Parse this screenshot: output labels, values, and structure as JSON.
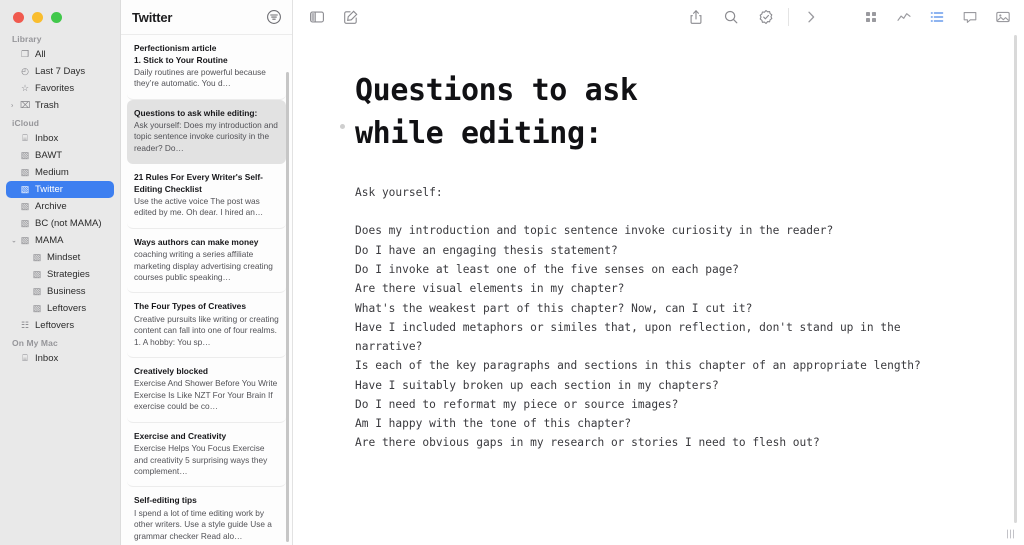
{
  "window": {
    "traffic_lights": [
      "close",
      "minimize",
      "maximize"
    ],
    "accent_color": "#3d7ff0",
    "sidebar_bg": "#e9e9e9"
  },
  "sidebar": {
    "groups": [
      {
        "label": "Library",
        "items": [
          {
            "label": "All",
            "icon": "note-stack-icon",
            "indent": false,
            "disclosure": "",
            "selected": false
          },
          {
            "label": "Last 7 Days",
            "icon": "clock-icon",
            "indent": false,
            "disclosure": "",
            "selected": false
          },
          {
            "label": "Favorites",
            "icon": "star-icon",
            "indent": false,
            "disclosure": "",
            "selected": false
          },
          {
            "label": "Trash",
            "icon": "trash-icon",
            "indent": false,
            "disclosure": "›",
            "selected": false
          }
        ]
      },
      {
        "label": "iCloud",
        "items": [
          {
            "label": "Inbox",
            "icon": "inbox-icon",
            "indent": false,
            "disclosure": "",
            "selected": false
          },
          {
            "label": "BAWT",
            "icon": "document-icon",
            "indent": false,
            "disclosure": "",
            "selected": false
          },
          {
            "label": "Medium",
            "icon": "document-icon",
            "indent": false,
            "disclosure": "",
            "selected": false
          },
          {
            "label": "Twitter",
            "icon": "document-icon",
            "indent": false,
            "disclosure": "",
            "selected": true
          },
          {
            "label": "Archive",
            "icon": "document-icon",
            "indent": false,
            "disclosure": "",
            "selected": false
          },
          {
            "label": "BC (not MAMA)",
            "icon": "document-icon",
            "indent": false,
            "disclosure": "",
            "selected": false
          },
          {
            "label": "MAMA",
            "icon": "document-icon",
            "indent": false,
            "disclosure": "⌄",
            "selected": false
          },
          {
            "label": "Mindset",
            "icon": "document-icon",
            "indent": true,
            "disclosure": "",
            "selected": false
          },
          {
            "label": "Strategies",
            "icon": "document-icon",
            "indent": true,
            "disclosure": "",
            "selected": false
          },
          {
            "label": "Business",
            "icon": "document-icon",
            "indent": true,
            "disclosure": "",
            "selected": false
          },
          {
            "label": "Leftovers",
            "icon": "document-icon",
            "indent": true,
            "disclosure": "",
            "selected": false
          },
          {
            "label": "Leftovers",
            "icon": "tray-icon",
            "indent": false,
            "disclosure": "",
            "selected": false
          }
        ]
      },
      {
        "label": "On My Mac",
        "items": [
          {
            "label": "Inbox",
            "icon": "inbox-icon",
            "indent": false,
            "disclosure": "",
            "selected": false
          }
        ]
      }
    ]
  },
  "notelist": {
    "title": "Twitter",
    "filter_icon": "filter-circle-icon",
    "notes": [
      {
        "title": "Perfectionism article",
        "subtitle": "1. Stick to Your Routine",
        "preview": "Daily routines are powerful because they’re automatic. You d…",
        "selected": false
      },
      {
        "title": "Questions to ask while editing:",
        "subtitle": "",
        "preview": "Ask yourself: Does my introduction and topic sentence invoke curiosity in the reader? Do…",
        "selected": true
      },
      {
        "title": "21 Rules For Every Writer's Self-Editing Checklist",
        "subtitle": "",
        "preview": "Use the active voice The post was edited by me. Oh dear. I hired an…",
        "selected": false
      },
      {
        "title": "Ways authors can make money",
        "subtitle": "",
        "preview": "coaching writing a series affiliate marketing display advertising creating courses public speaking…",
        "selected": false
      },
      {
        "title": "The Four Types of Creatives",
        "subtitle": "",
        "preview": "Creative pursuits like writing or creating content can fall into one of four realms. 1. A hobby: You sp…",
        "selected": false
      },
      {
        "title": "Creatively blocked",
        "subtitle": "",
        "preview": "Exercise And Shower Before You Write Exercise Is Like NZT For Your Brain If exercise could be co…",
        "selected": false
      },
      {
        "title": "Exercise and Creativity",
        "subtitle": "",
        "preview": "Exercise Helps You Focus Exercise and creativity 5 surprising ways they complement…",
        "selected": false
      },
      {
        "title": "Self-editing tips",
        "subtitle": "",
        "preview": "I spend a lot of time editing work by other writers. Use a style guide Use a grammar checker Read alo…",
        "selected": false
      }
    ]
  },
  "toolbar": {
    "left_icons": [
      {
        "name": "sidebar-toggle-icon",
        "active": false
      },
      {
        "name": "compose-note-icon",
        "active": false
      }
    ],
    "right_icons": [
      {
        "name": "share-icon",
        "active": false
      },
      {
        "name": "search-icon",
        "active": false
      },
      {
        "name": "checkmark-seal-icon",
        "active": false
      }
    ],
    "chevron_icon": "chevron-right-icon",
    "inspector_icons": [
      {
        "name": "grid-icon",
        "active": false
      },
      {
        "name": "activity-icon",
        "active": false
      },
      {
        "name": "list-icon",
        "active": true
      },
      {
        "name": "comment-icon",
        "active": false
      },
      {
        "name": "image-icon",
        "active": false
      }
    ]
  },
  "document": {
    "title": "Questions to ask while editing:",
    "intro": "Ask yourself:",
    "lines": [
      "Does my introduction and topic sentence invoke curiosity in the reader?",
      "Do I have an engaging thesis statement?",
      "Do I invoke at least one of the five senses on each page?",
      "Are there visual elements in my chapter?",
      "What's the weakest part of this chapter? Now, can I cut it?",
      "Have I included metaphors or similes that, upon reflection, don't stand up in the narrative?",
      "Is each of the key paragraphs and sections in this chapter of an appropriate length?",
      "Have I suitably broken up each section in my chapters?",
      "Do I need to reformat my piece or source images?",
      "Am I happy with the tone of this chapter?",
      "Are there obvious gaps in my research or stories I need to flesh out?"
    ]
  },
  "resize_grip": "resize-grip-icon"
}
